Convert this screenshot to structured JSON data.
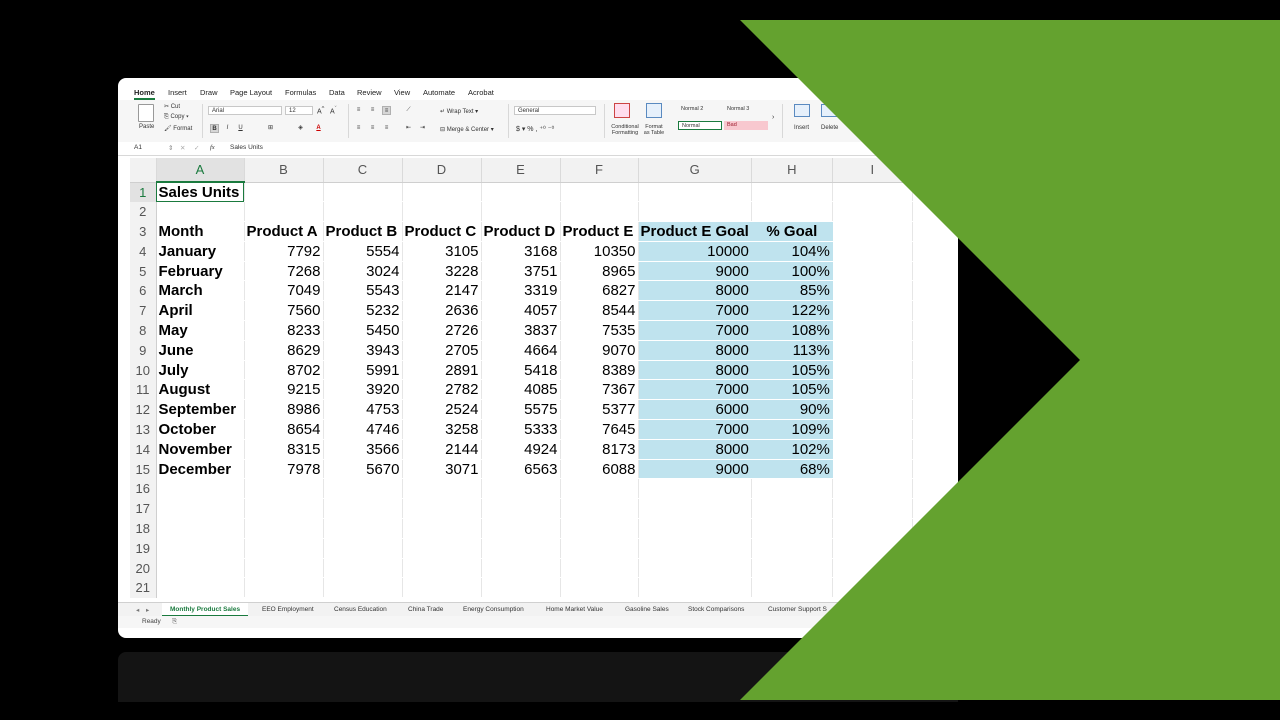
{
  "ribbon": {
    "tabs": [
      "Home",
      "Insert",
      "Draw",
      "Page Layout",
      "Formulas",
      "Data",
      "Review",
      "View",
      "Automate",
      "Acrobat"
    ],
    "paste": "Paste",
    "cut": "Cut",
    "copy": "Copy",
    "format": "Format",
    "font_name": "Arial",
    "font_size": "12",
    "wrap_text": "Wrap Text",
    "merge_center": "Merge & Center",
    "number_format": "General",
    "conditional_formatting": "Conditional Formatting",
    "format_as_table": "Format as Table",
    "styles": [
      "Normal 2",
      "Normal 3",
      "Normal",
      "Bad"
    ],
    "insert": "Insert",
    "delete": "Delete"
  },
  "formula_bar": {
    "name_box": "A1",
    "fx": "fx",
    "content": "Sales Units"
  },
  "grid": {
    "columns": [
      "A",
      "B",
      "C",
      "D",
      "E",
      "F",
      "G",
      "H",
      "I"
    ],
    "title": "Sales Units",
    "headers": [
      "Month",
      "Product A",
      "Product B",
      "Product C",
      "Product D",
      "Product E",
      "Product E Goal",
      "% Goal"
    ],
    "rows": [
      [
        "January",
        "7792",
        "5554",
        "3105",
        "3168",
        "10350",
        "10000",
        "104%"
      ],
      [
        "February",
        "7268",
        "3024",
        "3228",
        "3751",
        "8965",
        "9000",
        "100%"
      ],
      [
        "March",
        "7049",
        "5543",
        "2147",
        "3319",
        "6827",
        "8000",
        "85%"
      ],
      [
        "April",
        "7560",
        "5232",
        "2636",
        "4057",
        "8544",
        "7000",
        "122%"
      ],
      [
        "May",
        "8233",
        "5450",
        "2726",
        "3837",
        "7535",
        "7000",
        "108%"
      ],
      [
        "June",
        "8629",
        "3943",
        "2705",
        "4664",
        "9070",
        "8000",
        "113%"
      ],
      [
        "July",
        "8702",
        "5991",
        "2891",
        "5418",
        "8389",
        "8000",
        "105%"
      ],
      [
        "August",
        "9215",
        "3920",
        "2782",
        "4085",
        "7367",
        "7000",
        "105%"
      ],
      [
        "September",
        "8986",
        "4753",
        "2524",
        "5575",
        "5377",
        "6000",
        "90%"
      ],
      [
        "October",
        "8654",
        "4746",
        "3258",
        "5333",
        "7645",
        "7000",
        "109%"
      ],
      [
        "November",
        "8315",
        "3566",
        "2144",
        "4924",
        "8173",
        "8000",
        "102%"
      ],
      [
        "December",
        "7978",
        "5670",
        "3071",
        "6563",
        "6088",
        "9000",
        "68%"
      ]
    ],
    "row_numbers": [
      "1",
      "2",
      "3",
      "4",
      "5",
      "6",
      "7",
      "8",
      "9",
      "10",
      "11",
      "12",
      "13",
      "14",
      "15",
      "16",
      "17",
      "18",
      "19",
      "20",
      "21"
    ]
  },
  "sheet_tabs": [
    "Monthly Product Sales",
    "EEO Employment",
    "Census Education",
    "China Trade",
    "Energy Consumption",
    "Home Market Value",
    "Gasoline Sales",
    "Stock Comparisons",
    "Customer Support S"
  ],
  "status": "Ready",
  "colors": {
    "accent": "#1a7a3e",
    "highlight": "#bfe3ee",
    "banner": "#64a22f"
  }
}
